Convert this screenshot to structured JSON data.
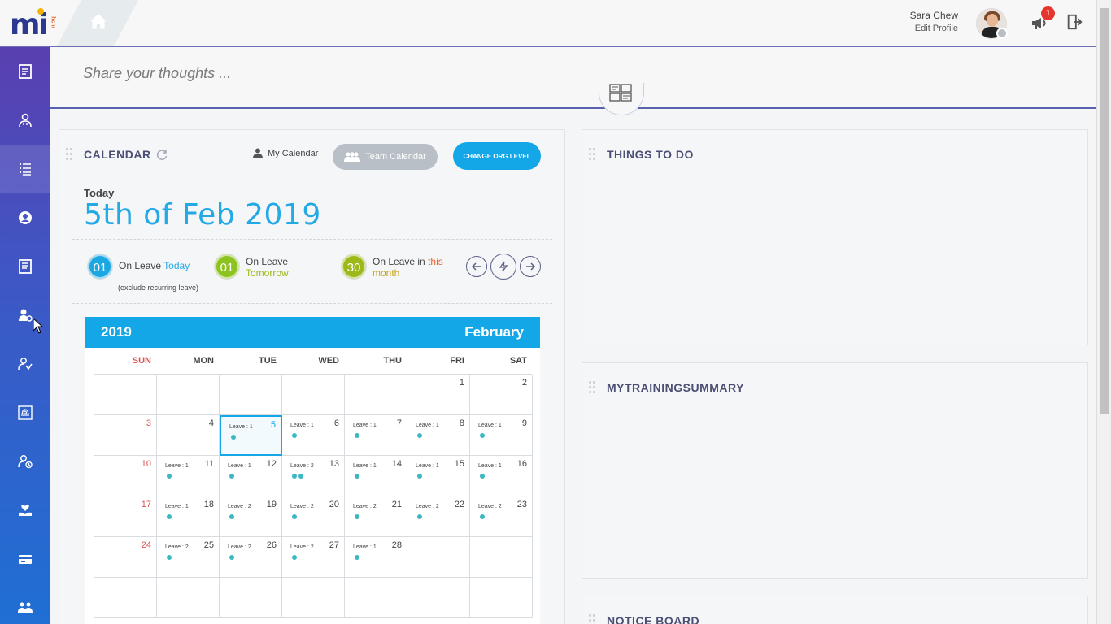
{
  "header": {
    "logo_text": "mi",
    "logo_sub": "hcm",
    "user_name": "Sara Chew",
    "edit_profile": "Edit Profile",
    "notification_count": "1"
  },
  "share": {
    "placeholder": "Share your thoughts ..."
  },
  "sidebar": {
    "items": [
      {
        "icon": "notepad-icon"
      },
      {
        "icon": "doctor-icon"
      },
      {
        "icon": "list-icon"
      },
      {
        "icon": "user-circle-icon"
      },
      {
        "icon": "document-edit-icon"
      },
      {
        "icon": "user-settings-icon"
      },
      {
        "icon": "user-tasks-icon"
      },
      {
        "icon": "fingerprint-icon"
      },
      {
        "icon": "user-clock-icon"
      },
      {
        "icon": "heart-hand-icon"
      },
      {
        "icon": "money-card-icon"
      },
      {
        "icon": "team-icon"
      }
    ]
  },
  "calendar": {
    "title": "CALENDAR",
    "my_calendar": "My Calendar",
    "team_calendar": "Team Calendar",
    "change_org": "CHANGE ORG LEVEL",
    "today_label": "Today",
    "today_date": "5th of Feb 2019",
    "stats": [
      {
        "num": "01",
        "text": "On Leave",
        "highlight": "Today",
        "color": "#1ba8e2"
      },
      {
        "num": "01",
        "text": "On Leave",
        "highlight": "Tomorrow",
        "color": "#8cc31e"
      },
      {
        "num": "30",
        "text": "On Leave in",
        "highlight": "this",
        "highlight2": "month",
        "color": "#9bba1a"
      }
    ],
    "exclude_note": "(exclude recurring leave)",
    "year": "2019",
    "month": "February",
    "weekdays": [
      "SUN",
      "MON",
      "TUE",
      "WED",
      "THU",
      "FRI",
      "SAT"
    ],
    "weeks": [
      [
        {
          "d": ""
        },
        {
          "d": ""
        },
        {
          "d": ""
        },
        {
          "d": ""
        },
        {
          "d": ""
        },
        {
          "d": "1"
        },
        {
          "d": "2"
        }
      ],
      [
        {
          "d": "3"
        },
        {
          "d": "4"
        },
        {
          "d": "5",
          "lv": "Leave : 1",
          "dots": 1,
          "today": true
        },
        {
          "d": "6",
          "lv": "Leave : 1",
          "dots": 1
        },
        {
          "d": "7",
          "lv": "Leave : 1",
          "dots": 1
        },
        {
          "d": "8",
          "lv": "Leave : 1",
          "dots": 1
        },
        {
          "d": "9",
          "lv": "Leave : 1",
          "dots": 1
        }
      ],
      [
        {
          "d": "10"
        },
        {
          "d": "11",
          "lv": "Leave : 1",
          "dots": 1
        },
        {
          "d": "12",
          "lv": "Leave : 1",
          "dots": 1
        },
        {
          "d": "13",
          "lv": "Leave : 2",
          "dots": 2
        },
        {
          "d": "14",
          "lv": "Leave : 1",
          "dots": 1
        },
        {
          "d": "15",
          "lv": "Leave : 1",
          "dots": 1
        },
        {
          "d": "16",
          "lv": "Leave : 1",
          "dots": 1
        }
      ],
      [
        {
          "d": "17"
        },
        {
          "d": "18",
          "lv": "Leave : 1",
          "dots": 1
        },
        {
          "d": "19",
          "lv": "Leave : 2",
          "dots": 1
        },
        {
          "d": "20",
          "lv": "Leave : 2",
          "dots": 1
        },
        {
          "d": "21",
          "lv": "Leave : 2",
          "dots": 1
        },
        {
          "d": "22",
          "lv": "Leave : 2",
          "dots": 1
        },
        {
          "d": "23",
          "lv": "Leave : 2",
          "dots": 1
        }
      ],
      [
        {
          "d": "24"
        },
        {
          "d": "25",
          "lv": "Leave : 2",
          "dots": 1
        },
        {
          "d": "26",
          "lv": "Leave : 2",
          "dots": 1
        },
        {
          "d": "27",
          "lv": "Leave : 2",
          "dots": 1
        },
        {
          "d": "28",
          "lv": "Leave : 1",
          "dots": 1
        },
        {
          "d": ""
        },
        {
          "d": ""
        }
      ],
      [
        {
          "d": ""
        },
        {
          "d": ""
        },
        {
          "d": ""
        },
        {
          "d": ""
        },
        {
          "d": ""
        },
        {
          "d": ""
        },
        {
          "d": ""
        }
      ]
    ]
  },
  "cards": {
    "things_to_do": "THINGS TO DO",
    "training": "MYTRAININGSUMMARY",
    "notice": "NOTICE BOARD"
  },
  "colors": {
    "accent": "#13a7e8",
    "sidebar_top": "#5a3fb0",
    "sidebar_bottom": "#1f6fd4",
    "leave_dot": "#3bb8c3"
  }
}
